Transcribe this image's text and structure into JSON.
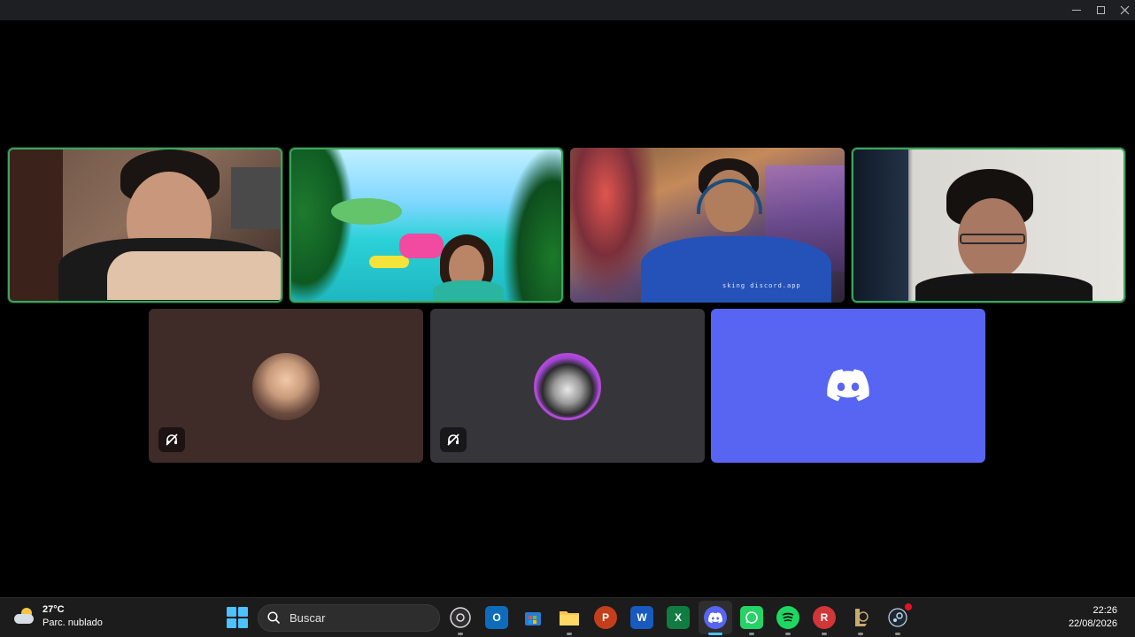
{
  "window": {
    "controls": {
      "minimize": "minimize",
      "maximize": "maximize",
      "close": "close"
    }
  },
  "call": {
    "video_tiles": [
      {
        "id": "participant-1",
        "type": "camera",
        "speaking": true
      },
      {
        "id": "participant-2",
        "type": "camera",
        "speaking": true
      },
      {
        "id": "participant-3",
        "type": "camera",
        "speaking": false,
        "overlay_text": "sking  discord.app"
      },
      {
        "id": "participant-4",
        "type": "camera",
        "speaking": true
      }
    ],
    "avatar_tiles": [
      {
        "id": "participant-5",
        "deafened": true,
        "icon": "deafened-icon"
      },
      {
        "id": "participant-6",
        "deafened": true,
        "icon": "deafened-icon"
      }
    ],
    "brand_tile": {
      "icon": "discord-logo-icon",
      "bg_color": "#5865f2"
    }
  },
  "taskbar": {
    "weather": {
      "temp": "27°C",
      "condition": "Parc. nublado",
      "icon": "partly-cloudy-icon"
    },
    "search": {
      "placeholder": "Buscar"
    },
    "apps": [
      {
        "name": "obs",
        "icon": "obs-icon"
      },
      {
        "name": "outlook",
        "icon": "outlook-icon"
      },
      {
        "name": "store",
        "icon": "microsoft-store-icon"
      },
      {
        "name": "explorer",
        "icon": "file-explorer-icon"
      },
      {
        "name": "powerpoint",
        "icon": "powerpoint-icon"
      },
      {
        "name": "word",
        "icon": "word-icon"
      },
      {
        "name": "excel",
        "icon": "excel-icon"
      },
      {
        "name": "discord",
        "icon": "discord-icon",
        "active": true
      },
      {
        "name": "whatsapp",
        "icon": "whatsapp-icon"
      },
      {
        "name": "spotify",
        "icon": "spotify-icon"
      },
      {
        "name": "riot",
        "icon": "riot-client-icon"
      },
      {
        "name": "league",
        "icon": "league-of-legends-icon"
      },
      {
        "name": "steam",
        "icon": "steam-icon",
        "notification": true
      }
    ],
    "clock": {
      "time": "22:26",
      "date": "22/08/2026"
    }
  },
  "colors": {
    "accent": "#4cc2ff",
    "speaking": "#3ba55c",
    "discord": "#5865f2"
  }
}
